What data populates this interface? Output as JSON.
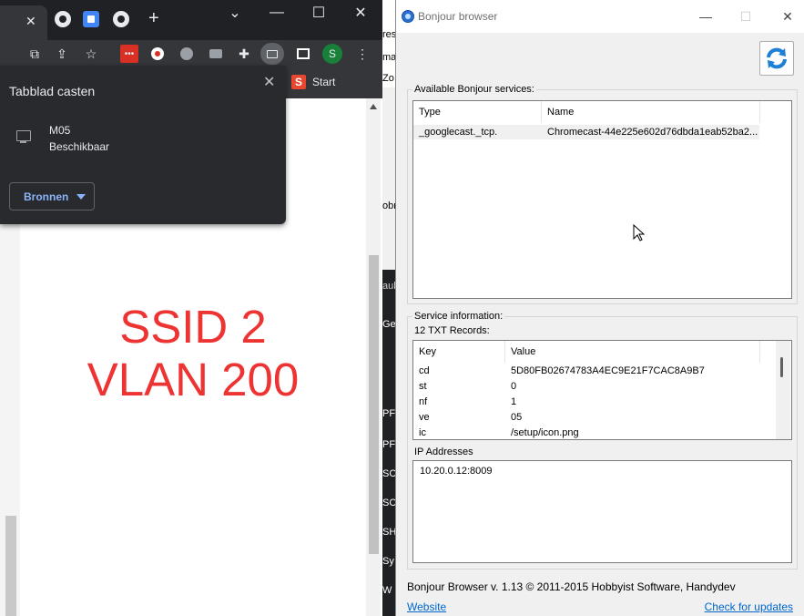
{
  "chrome": {
    "new_tab_symbol": "+",
    "bookmarks": {
      "start_label": "Start",
      "start_icon_letter": "S"
    },
    "profile_letter": "S",
    "cast": {
      "title": "Tabblad casten",
      "device": {
        "name": "M05",
        "status": "Beschikbaar"
      },
      "sources_label": "Bronnen"
    },
    "page": {
      "line1": "SSID 2",
      "line2": "VLAN 200"
    }
  },
  "middle_fragments": [
    "res",
    "ma",
    "Zo",
    "obr",
    "aub",
    "Geu",
    "PF",
    "PF",
    "SC",
    "SC",
    "SH",
    "Sy",
    "W"
  ],
  "bonjour": {
    "window_title": "Bonjour browser",
    "available_label": "Available Bonjour services:",
    "services_columns": [
      "Type",
      "Name"
    ],
    "services": [
      {
        "type": "_googlecast._tcp.",
        "name": "Chromecast-44e225e602d76dbda1eab52ba2..."
      }
    ],
    "service_info_label": "Service information:",
    "txt_count_label": "12 TXT Records:",
    "txt_columns": [
      "Key",
      "Value"
    ],
    "txt_records": [
      {
        "key": "cd",
        "value": "5D80FB02674783A4EC9E21F7CAC8A9B7"
      },
      {
        "key": "st",
        "value": "0"
      },
      {
        "key": "nf",
        "value": "1"
      },
      {
        "key": "ve",
        "value": "05"
      },
      {
        "key": "ic",
        "value": "/setup/icon.png"
      }
    ],
    "ip_label": "IP Addresses",
    "ip_addresses": [
      "10.20.0.12:8009"
    ],
    "footer": "Bonjour Browser v. 1.13 © 2011-2015 Hobbyist Software, Handydev",
    "website_label": "Website",
    "updates_label": "Check for updates"
  },
  "colors": {
    "chrome_dark": "#202124",
    "chrome_toolbar": "#35363a",
    "page_text_red": "#ee3333",
    "link_blue": "#0066cc",
    "cast_accent": "#8ab4f8"
  }
}
